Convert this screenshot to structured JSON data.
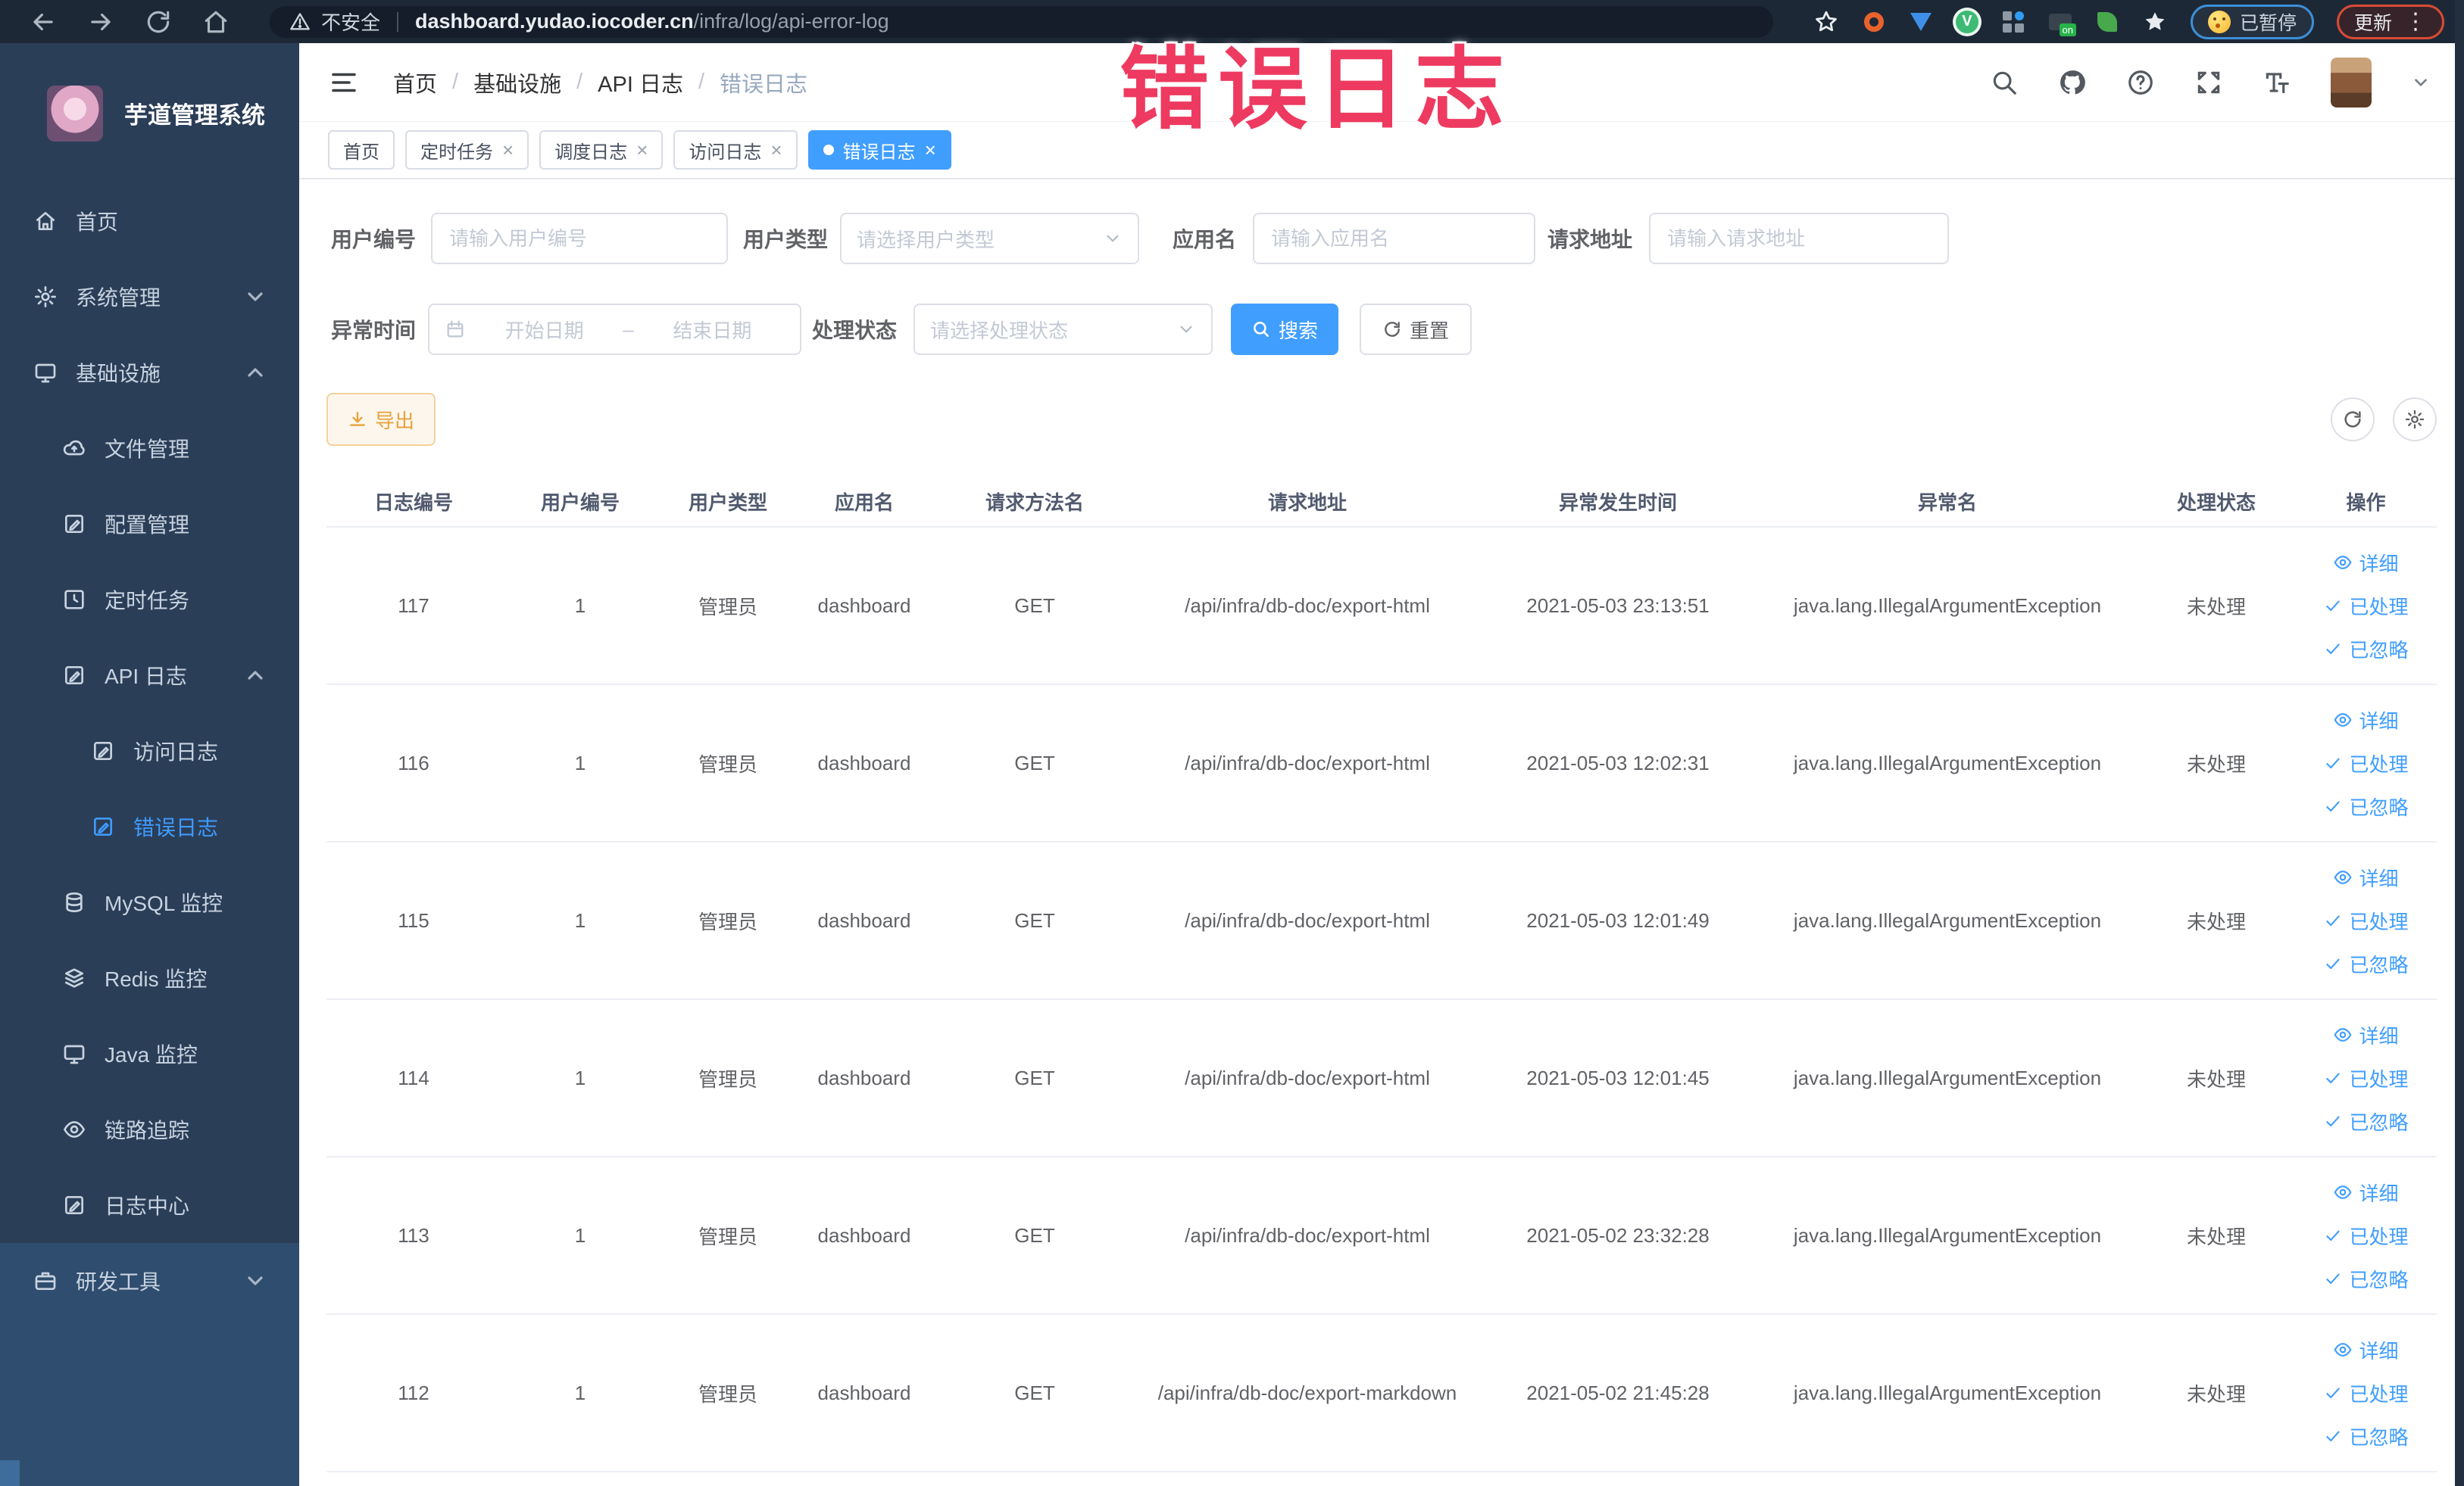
{
  "browser": {
    "security_label": "不安全",
    "url_domain": "dashboard.yudao.iocoder.cn",
    "url_path": "/infra/log/api-error-log",
    "paused_label": "已暂停",
    "update_label": "更新",
    "menu_glyph": "⋮"
  },
  "overlay": {
    "title": "错误日志"
  },
  "sidebar": {
    "logo_title": "芋道管理系统",
    "items": [
      {
        "id": "home",
        "label": "首页",
        "icon": "home",
        "depth": 0,
        "section": "top"
      },
      {
        "id": "system",
        "label": "系统管理",
        "icon": "gear",
        "depth": 0,
        "section": "top",
        "chevron": "down"
      },
      {
        "id": "infra",
        "label": "基础设施",
        "icon": "monitor",
        "depth": 0,
        "section": "top",
        "chevron": "up"
      },
      {
        "id": "file",
        "label": "文件管理",
        "icon": "cloud",
        "depth": 1,
        "section": "top"
      },
      {
        "id": "config",
        "label": "配置管理",
        "icon": "edit",
        "depth": 1,
        "section": "top"
      },
      {
        "id": "job",
        "label": "定时任务",
        "icon": "clock",
        "depth": 1,
        "section": "top"
      },
      {
        "id": "api-log",
        "label": "API 日志",
        "icon": "edit",
        "depth": 1,
        "section": "top",
        "chevron": "up"
      },
      {
        "id": "access-log",
        "label": "访问日志",
        "icon": "edit",
        "depth": 2,
        "section": "top"
      },
      {
        "id": "error-log",
        "label": "错误日志",
        "icon": "edit",
        "depth": 2,
        "section": "top",
        "active": true
      },
      {
        "id": "mysql",
        "label": "MySQL 监控",
        "icon": "db",
        "depth": 1,
        "section": "top"
      },
      {
        "id": "redis",
        "label": "Redis 监控",
        "icon": "layers",
        "depth": 1,
        "section": "top"
      },
      {
        "id": "java",
        "label": "Java 监控",
        "icon": "monitor",
        "depth": 1,
        "section": "top"
      },
      {
        "id": "trace",
        "label": "链路追踪",
        "icon": "eye",
        "depth": 1,
        "section": "top"
      },
      {
        "id": "log-center",
        "label": "日志中心",
        "icon": "edit",
        "depth": 1,
        "section": "top"
      },
      {
        "id": "dev-tools",
        "label": "研发工具",
        "icon": "briefcase",
        "depth": 0,
        "section": "bottom",
        "chevron": "down"
      }
    ]
  },
  "breadcrumb": {
    "items": [
      "首页",
      "基础设施",
      "API 日志",
      "错误日志"
    ]
  },
  "tags": [
    {
      "label": "首页",
      "closable": false,
      "active": false
    },
    {
      "label": "定时任务",
      "closable": true,
      "active": false
    },
    {
      "label": "调度日志",
      "closable": true,
      "active": false
    },
    {
      "label": "访问日志",
      "closable": true,
      "active": false
    },
    {
      "label": "错误日志",
      "closable": true,
      "active": true
    }
  ],
  "filters": {
    "user_id": {
      "label": "用户编号",
      "placeholder": "请输入用户编号"
    },
    "user_type": {
      "label": "用户类型",
      "placeholder": "请选择用户类型"
    },
    "app_name": {
      "label": "应用名",
      "placeholder": "请输入应用名"
    },
    "request_url": {
      "label": "请求地址",
      "placeholder": "请输入请求地址"
    },
    "exception_time": {
      "label": "异常时间",
      "start_placeholder": "开始日期",
      "separator": "–",
      "end_placeholder": "结束日期"
    },
    "process_status": {
      "label": "处理状态",
      "placeholder": "请选择处理状态"
    },
    "search_label": "搜索",
    "reset_label": "重置"
  },
  "toolbar": {
    "export_label": "导出"
  },
  "table": {
    "columns": [
      "日志编号",
      "用户编号",
      "用户类型",
      "应用名",
      "请求方法名",
      "请求地址",
      "异常发生时间",
      "异常名",
      "处理状态",
      "操作"
    ],
    "actions": [
      "详细",
      "已处理",
      "已忽略"
    ],
    "rows": [
      [
        "117",
        "1",
        "管理员",
        "dashboard",
        "GET",
        "/api/infra/db-doc/export-html",
        "2021-05-03 23:13:51",
        "java.lang.IllegalArgumentException",
        "未处理"
      ],
      [
        "116",
        "1",
        "管理员",
        "dashboard",
        "GET",
        "/api/infra/db-doc/export-html",
        "2021-05-03 12:02:31",
        "java.lang.IllegalArgumentException",
        "未处理"
      ],
      [
        "115",
        "1",
        "管理员",
        "dashboard",
        "GET",
        "/api/infra/db-doc/export-html",
        "2021-05-03 12:01:49",
        "java.lang.IllegalArgumentException",
        "未处理"
      ],
      [
        "114",
        "1",
        "管理员",
        "dashboard",
        "GET",
        "/api/infra/db-doc/export-html",
        "2021-05-03 12:01:45",
        "java.lang.IllegalArgumentException",
        "未处理"
      ],
      [
        "113",
        "1",
        "管理员",
        "dashboard",
        "GET",
        "/api/infra/db-doc/export-html",
        "2021-05-02 23:32:28",
        "java.lang.IllegalArgumentException",
        "未处理"
      ],
      [
        "112",
        "1",
        "管理员",
        "dashboard",
        "GET",
        "/api/infra/db-doc/export-markdown",
        "2021-05-02 21:45:28",
        "java.lang.IllegalArgumentException",
        "未处理"
      ]
    ]
  },
  "colors": {
    "accent": "#409eff",
    "warning": "#e6a23c",
    "overlay_pink": "#ee3a60",
    "sidebar": "#2b3e58",
    "sidebar_light": "#2f4d6e"
  }
}
